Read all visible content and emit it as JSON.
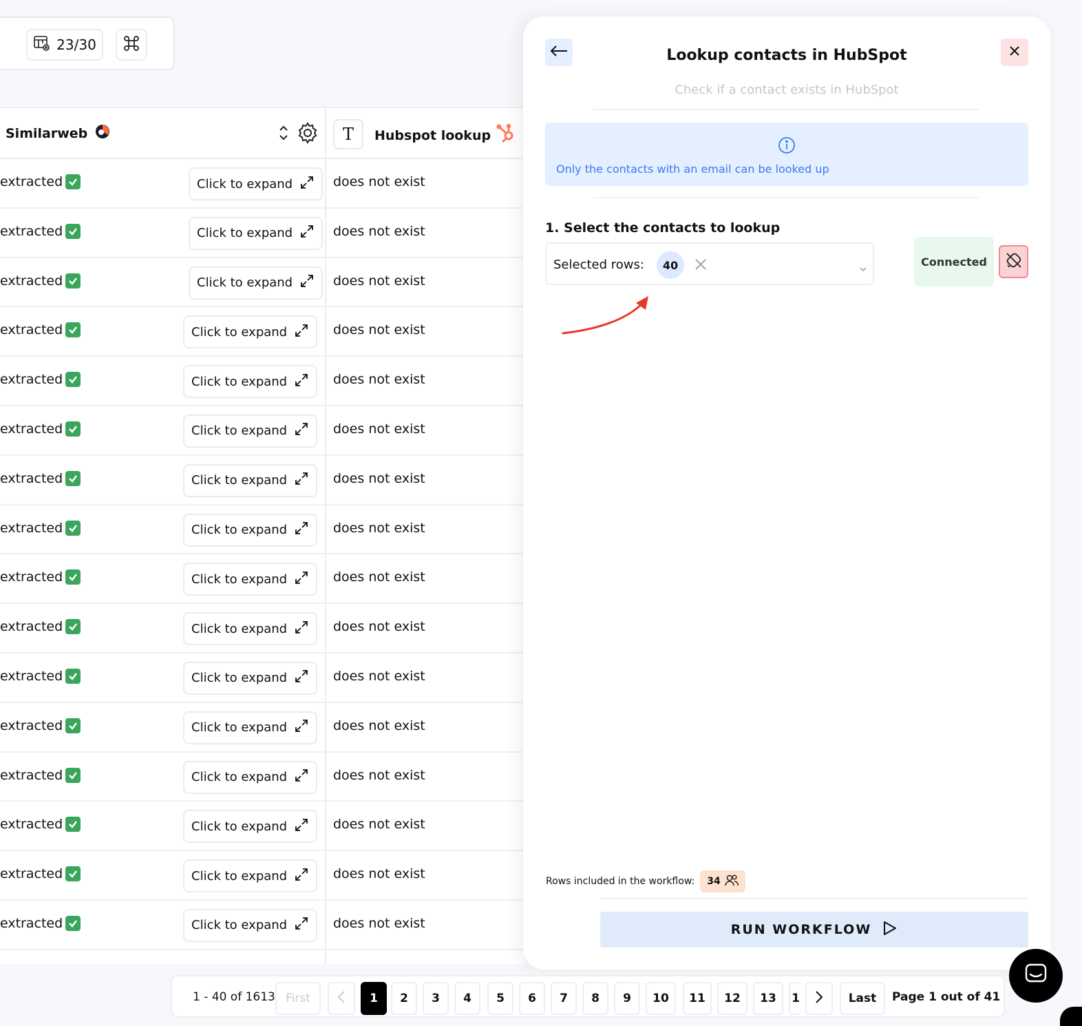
{
  "toolbar": {
    "counter_label": "23/30"
  },
  "table": {
    "columns": {
      "similarweb": "Similarweb",
      "hubspot": "Hubspot lookup"
    },
    "rows": [
      {
        "status": "extracted",
        "expand": "Click to expand",
        "hubspot": "does not exist"
      },
      {
        "status": "extracted",
        "expand": "Click to expand",
        "hubspot": "does not exist"
      },
      {
        "status": "extracted",
        "expand": "Click to expand",
        "hubspot": "does not exist"
      },
      {
        "status": "extracted",
        "expand": "Click to expand",
        "hubspot": "does not exist"
      },
      {
        "status": "extracted",
        "expand": "Click to expand",
        "hubspot": "does not exist"
      },
      {
        "status": "extracted",
        "expand": "Click to expand",
        "hubspot": "does not exist"
      },
      {
        "status": "extracted",
        "expand": "Click to expand",
        "hubspot": "does not exist"
      },
      {
        "status": "extracted",
        "expand": "Click to expand",
        "hubspot": "does not exist"
      },
      {
        "status": "extracted",
        "expand": "Click to expand",
        "hubspot": "does not exist"
      },
      {
        "status": "extracted",
        "expand": "Click to expand",
        "hubspot": "does not exist"
      },
      {
        "status": "extracted",
        "expand": "Click to expand",
        "hubspot": "does not exist"
      },
      {
        "status": "extracted",
        "expand": "Click to expand",
        "hubspot": "does not exist"
      },
      {
        "status": "extracted",
        "expand": "Click to expand",
        "hubspot": "does not exist"
      },
      {
        "status": "extracted",
        "expand": "Click to expand",
        "hubspot": "does not exist"
      },
      {
        "status": "extracted",
        "expand": "Click to expand",
        "hubspot": "does not exist"
      },
      {
        "status": "extracted",
        "expand": "Click to expand",
        "hubspot": "does not exist"
      }
    ]
  },
  "panel": {
    "title": "Lookup contacts in HubSpot",
    "subtitle": "Check if a contact exists in HubSpot",
    "info": "Only the contacts with an email can be looked up",
    "step1_label": "1. Select the contacts to lookup",
    "select": {
      "label": "Selected rows:",
      "count": "40"
    },
    "connection_status": "Connected",
    "rows_included_label": "Rows included in the workflow:",
    "rows_included_count": "34",
    "run_button": "RUN WORKFLOW"
  },
  "pagination": {
    "range": "1 - 40 of 1613",
    "first": "First",
    "last": "Last",
    "pages": [
      "1",
      "2",
      "3",
      "4",
      "5",
      "6",
      "7",
      "8",
      "9",
      "10",
      "11",
      "12",
      "13",
      "1"
    ],
    "current_page": "1",
    "page_info": "Page 1 out of 41"
  },
  "colors": {
    "accent_blue": "#3b7bf0",
    "connected_bg": "#e8f8ef",
    "danger": "#e85a5a",
    "hubspot_orange": "#ff7a59",
    "check_green": "#3ba55c"
  },
  "icons": {
    "toolbar": [
      "table-settings-icon",
      "command-icon"
    ],
    "header": [
      "similarweb-logo-icon",
      "sort-icon",
      "gear-icon",
      "text-type-icon",
      "hubspot-logo-icon"
    ],
    "panel": [
      "arrow-left-icon",
      "close-icon",
      "info-icon",
      "clear-x-icon",
      "chevron-down-icon",
      "plug-disconnect-icon",
      "users-icon",
      "play-icon"
    ],
    "other": [
      "chat-icon"
    ]
  }
}
